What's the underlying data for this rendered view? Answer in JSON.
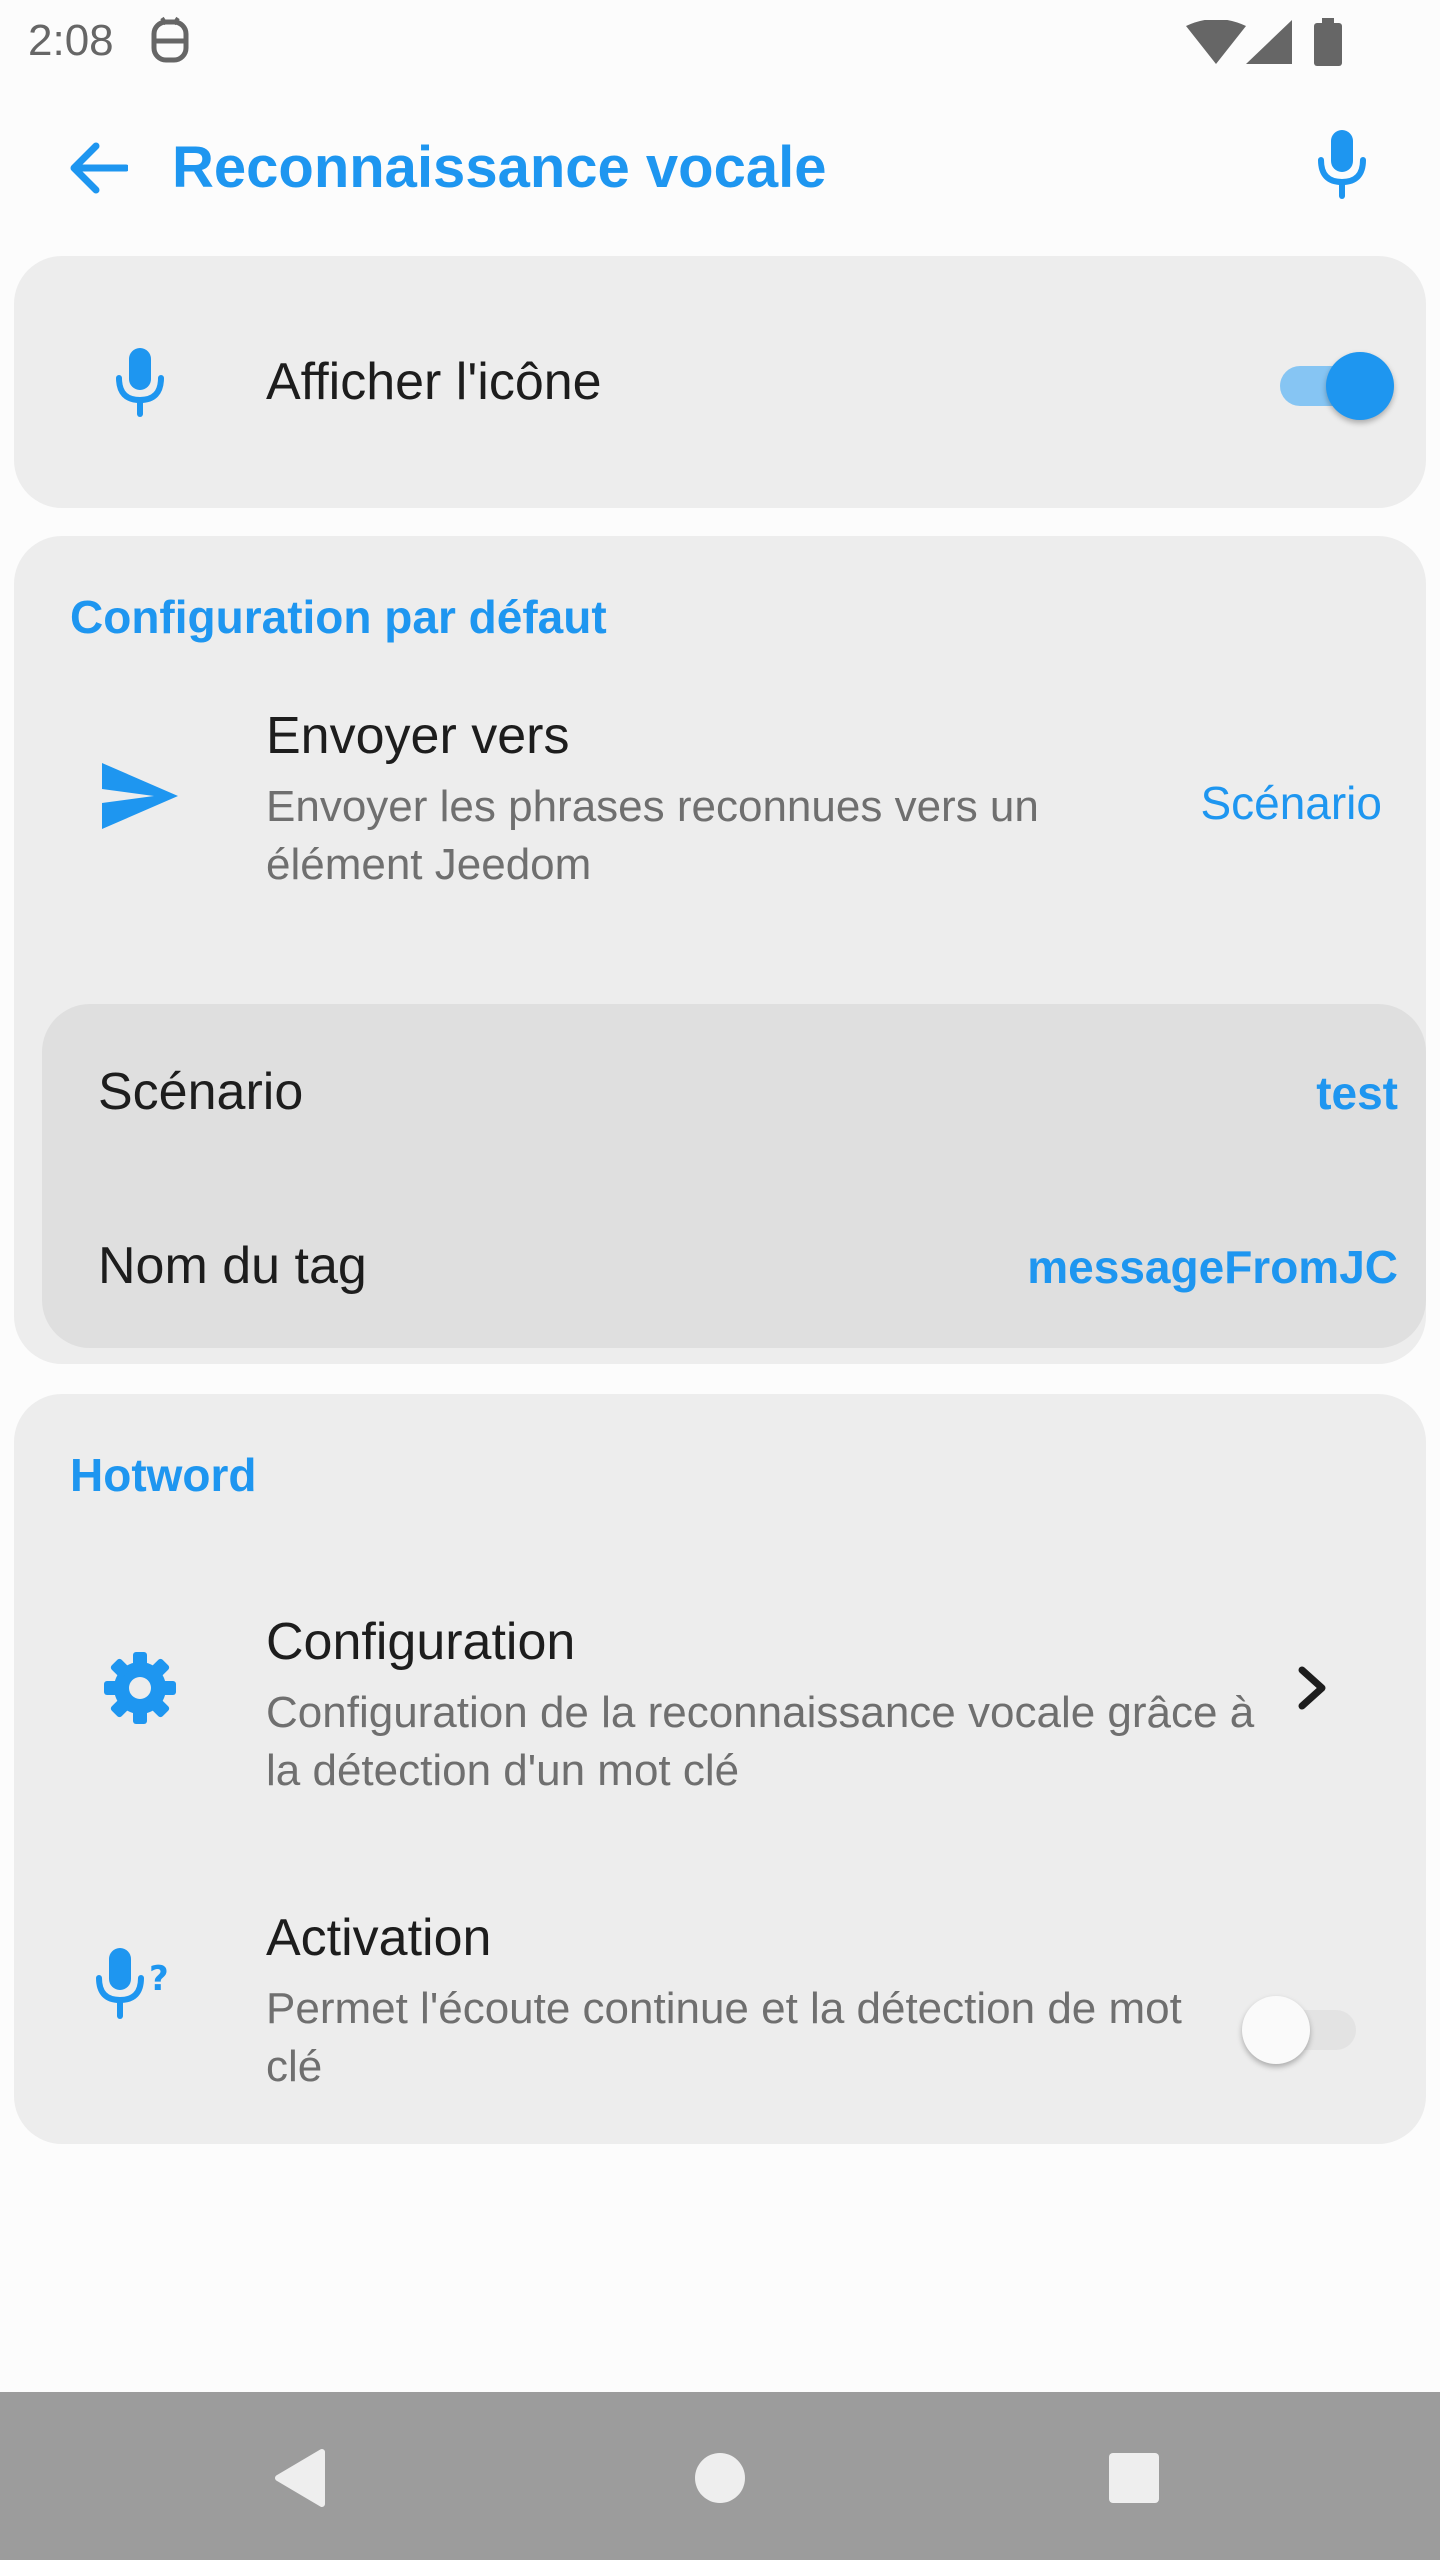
{
  "status_bar": {
    "time": "2:08",
    "icons": [
      "notification-icon",
      "wifi-icon",
      "signal-icon",
      "battery-icon"
    ]
  },
  "app_bar": {
    "title": "Reconnaissance vocale",
    "back_icon": "arrow-back-icon",
    "action_icon": "microphone-icon"
  },
  "show_icon_card": {
    "label": "Afficher l'icône",
    "icon": "microphone-icon",
    "toggle_on": true
  },
  "default_config": {
    "section_title": "Configuration par défaut",
    "send_to": {
      "title": "Envoyer vers",
      "summary": "Envoyer les phrases reconnues vers un élément Jeedom",
      "value": "Scénario",
      "icon": "send-icon"
    },
    "nested": {
      "scenario_label": "Scénario",
      "scenario_value": "test",
      "tag_label": "Nom du tag",
      "tag_value": "messageFromJC"
    }
  },
  "hotword": {
    "section_title": "Hotword",
    "configuration": {
      "title": "Configuration",
      "summary": "Configuration de la reconnaissance vocale grâce à la détection d'un mot clé",
      "icon": "gear-icon",
      "chevron": "chevron-right-icon"
    },
    "activation": {
      "title": "Activation",
      "summary": "Permet l'écoute continue et la détection de mot clé",
      "icon": "mic-question-icon",
      "toggle_on": false
    }
  },
  "nav_bar": {
    "icons": [
      "back-triangle-icon",
      "home-circle-icon",
      "recents-square-icon"
    ]
  },
  "colors": {
    "accent": "#1e96f0",
    "card_bg": "#ededed",
    "nested_bg": "#dfdfdf",
    "nav_bg": "#9c9c9c"
  }
}
